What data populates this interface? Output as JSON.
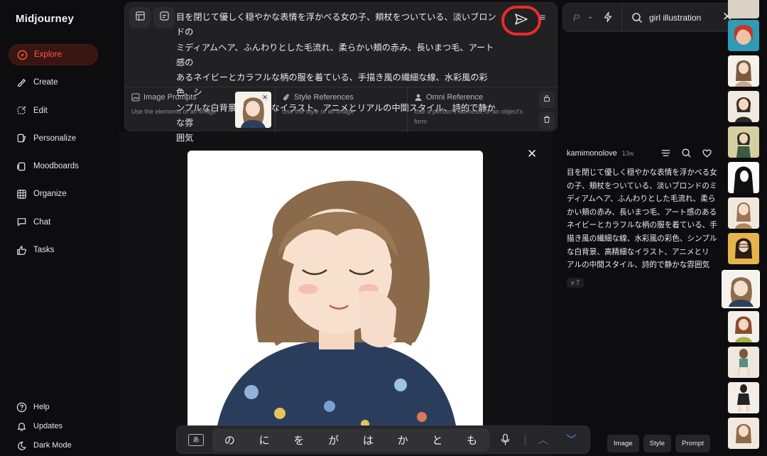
{
  "app": {
    "name": "Midjourney"
  },
  "sidebar": {
    "items": [
      {
        "label": "Explore",
        "icon": "compass-icon",
        "active": true
      },
      {
        "label": "Create",
        "icon": "brush-icon"
      },
      {
        "label": "Edit",
        "icon": "edit-icon"
      },
      {
        "label": "Personalize",
        "icon": "personalize-icon"
      },
      {
        "label": "Moodboards",
        "icon": "moodboard-icon"
      },
      {
        "label": "Organize",
        "icon": "grid-icon"
      },
      {
        "label": "Chat",
        "icon": "chat-icon"
      },
      {
        "label": "Tasks",
        "icon": "thumbs-up-icon"
      }
    ],
    "bottom": [
      {
        "label": "Help",
        "icon": "help-icon"
      },
      {
        "label": "Updates",
        "icon": "bell-icon"
      },
      {
        "label": "Dark Mode",
        "icon": "moon-icon"
      }
    ]
  },
  "prompt": {
    "lines": [
      "目を閉じて優しく穏やかな表情を浮かべる女の子、頬杖をついている、淡いブロンドの",
      "ミディアムヘア、ふんわりとした毛流れ、柔らかい頬の赤み、長いまつ毛、アート感の",
      "あるネイビーとカラフルな柄の服を着ている、手描き風の繊細な線、水彩風の彩色、シ",
      "ンプルな白背景、高精細なイラスト、アニメとリアルの中間スタイル、詩的で静かな雰",
      "囲気"
    ]
  },
  "references": {
    "image_prompts": {
      "title": "Image Prompts",
      "subtitle": "Use the elements of an image"
    },
    "style_references": {
      "title": "Style References",
      "subtitle": "Use the style of an image"
    },
    "omni_reference": {
      "title": "Omni Reference",
      "subtitle": "Use a person's likeness, or an object's form"
    }
  },
  "search": {
    "value": "girl illustration",
    "mode_letter": "P"
  },
  "detail": {
    "author": "kamimonolove",
    "age": "13w",
    "prompt_lines": [
      "目を閉じて優しく穏やかな表情を浮かべる女",
      "の子、頬杖をついている、淡いブロンドのミ",
      "ディアムヘア、ふんわりとした毛流れ、柔ら",
      "かい頬の赤み、長いまつ毛、アート感のある",
      "ネイビーとカラフルな柄の服を着ている、手",
      "描き風の繊細な線、水彩風の彩色、シンプル",
      "な白背景、高精細なイラスト、アニメとリ",
      "アルの中間スタイル、詩的で静かな雰囲気"
    ],
    "version": "v 7"
  },
  "bottom_tabs": [
    "Image",
    "Style",
    "Prompt"
  ],
  "keyboard": {
    "key_label": "あ",
    "suggestions": [
      "の",
      "に",
      "を",
      "が",
      "は",
      "か",
      "と",
      "も"
    ]
  },
  "colors": {
    "accent": "#ff5a43",
    "active_bg": "#3a1512",
    "highlight_ring": "#ee2a2a",
    "background": "#0d0d0f",
    "panel": "#212124"
  }
}
